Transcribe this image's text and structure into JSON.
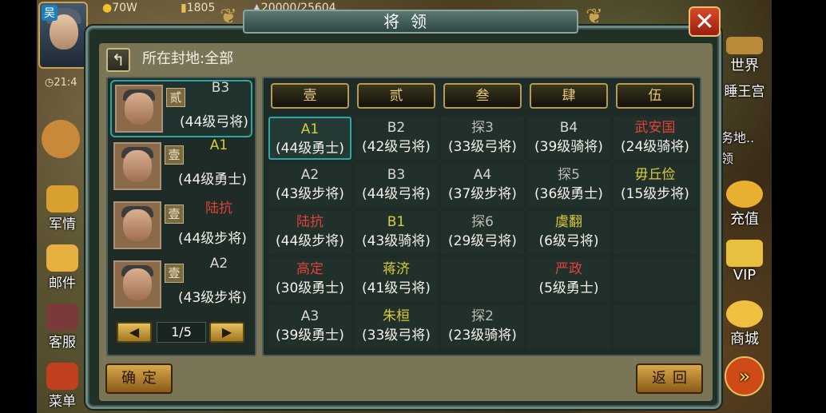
{
  "hud": {
    "avatar_tag": "吴",
    "gold": "70W",
    "food": "1805",
    "troops": "20000/25604",
    "clock": "21:4"
  },
  "side_left": [
    {
      "label": "军情"
    },
    {
      "label": "邮件"
    },
    {
      "label": "客服"
    },
    {
      "label": "菜单"
    }
  ],
  "side_right": [
    {
      "label": "世界"
    },
    {
      "label": "睡王宫"
    },
    {
      "label": "务地..领"
    },
    {
      "label": "充值"
    },
    {
      "label": "VIP"
    },
    {
      "label": "商城"
    }
  ],
  "window": {
    "title": "将领",
    "close": "✕",
    "fief_label": "所在封地:全部",
    "confirm": "确定",
    "back": "返回"
  },
  "generals": [
    {
      "rank": "贰",
      "name": "B3",
      "desc": "(44级弓将)",
      "color": "#d8d8d0",
      "selected": true
    },
    {
      "rank": "壹",
      "name": "A1",
      "desc": "(44级勇士)",
      "color": "#d8cc3a",
      "selected": false
    },
    {
      "rank": "壹",
      "name": "陆抗",
      "desc": "(44级步将)",
      "color": "#e0423a",
      "selected": false
    },
    {
      "rank": "壹",
      "name": "A2",
      "desc": "(43级步将)",
      "color": "#d8d8d0",
      "selected": false
    }
  ],
  "pager": {
    "prev": "◀",
    "text": "1/5",
    "next": "▶"
  },
  "columns": [
    "壹",
    "贰",
    "叁",
    "肆",
    "伍"
  ],
  "grid": [
    [
      {
        "name": "A1",
        "desc": "(44级勇士)",
        "color": "yellow",
        "selected": true
      },
      {
        "name": "A2",
        "desc": "(43级步将)",
        "color": "white"
      },
      {
        "name": "陆抗",
        "desc": "(44级步将)",
        "color": "red"
      },
      {
        "name": "高定",
        "desc": "(30级勇士)",
        "color": "red"
      },
      {
        "name": "A3",
        "desc": "(39级勇士)",
        "color": "white"
      }
    ],
    [
      {
        "name": "B2",
        "desc": "(42级弓将)",
        "color": "white"
      },
      {
        "name": "B3",
        "desc": "(44级弓将)",
        "color": "white"
      },
      {
        "name": "B1",
        "desc": "(43级骑将)",
        "color": "yellow"
      },
      {
        "name": "蒋济",
        "desc": "(41级弓将)",
        "color": "yellow"
      },
      {
        "name": "朱桓",
        "desc": "(33级弓将)",
        "color": "yellow"
      }
    ],
    [
      {
        "name": "探3",
        "desc": "(33级弓将)",
        "color": "grey"
      },
      {
        "name": "A4",
        "desc": "(37级步将)",
        "color": "white"
      },
      {
        "name": "探6",
        "desc": "(29级弓将)",
        "color": "grey"
      },
      null,
      {
        "name": "探2",
        "desc": "(23级骑将)",
        "color": "grey"
      }
    ],
    [
      {
        "name": "B4",
        "desc": "(39级骑将)",
        "color": "white"
      },
      {
        "name": "探5",
        "desc": "(36级勇士)",
        "color": "grey"
      },
      {
        "name": "虞翻",
        "desc": "(6级弓将)",
        "color": "yellow"
      },
      {
        "name": "严政",
        "desc": "(5级勇士)",
        "color": "red"
      },
      null
    ],
    [
      {
        "name": "武安国",
        "desc": "(24级骑将)",
        "color": "red"
      },
      {
        "name": "毋丘俭",
        "desc": "(15级步将)",
        "color": "yellow"
      },
      null,
      null,
      null
    ]
  ]
}
